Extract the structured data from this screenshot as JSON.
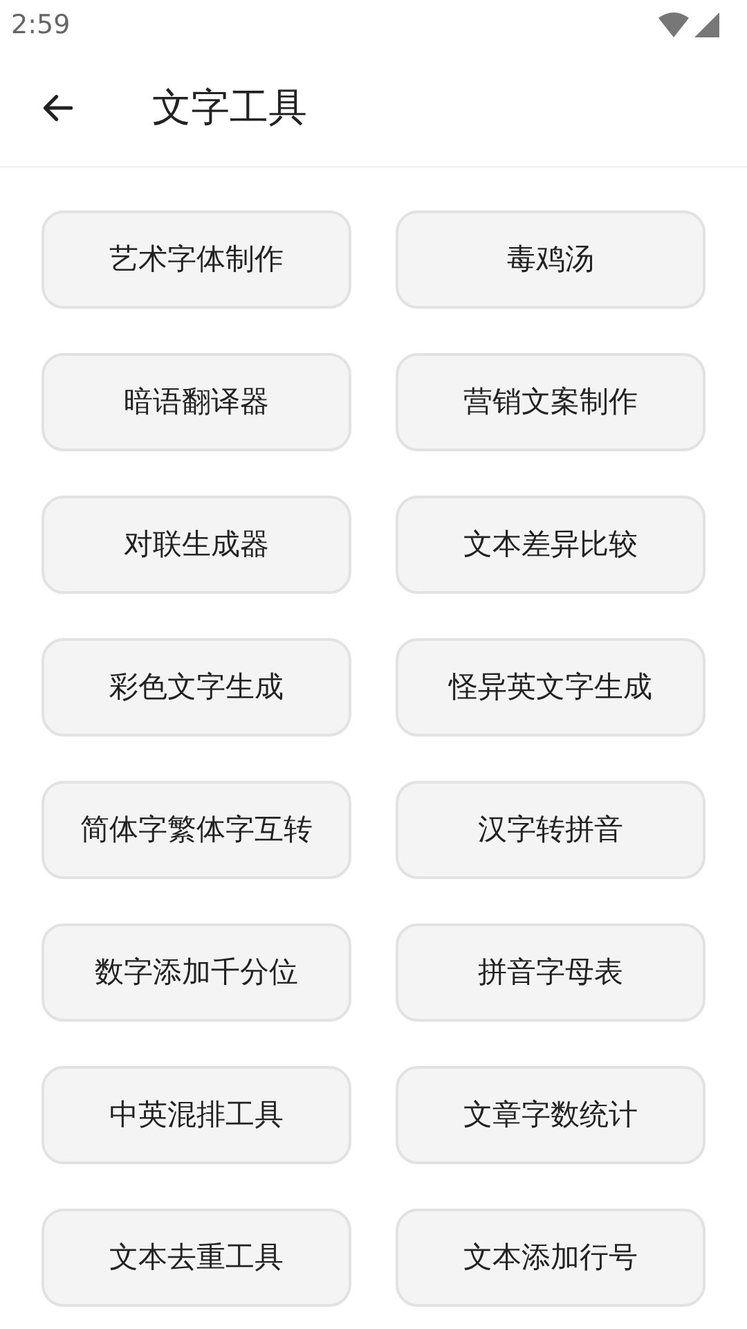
{
  "status_bar": {
    "time": "2:59"
  },
  "header": {
    "title": "文字工具"
  },
  "tools": [
    "艺术字体制作",
    "毒鸡汤",
    "暗语翻译器",
    "营销文案制作",
    "对联生成器",
    "文本差异比较",
    "彩色文字生成",
    "怪异英文字生成",
    "简体字繁体字互转",
    "汉字转拼音",
    "数字添加千分位",
    "拼音字母表",
    "中英混排工具",
    "文章字数统计",
    "文本去重工具",
    "文本添加行号"
  ]
}
